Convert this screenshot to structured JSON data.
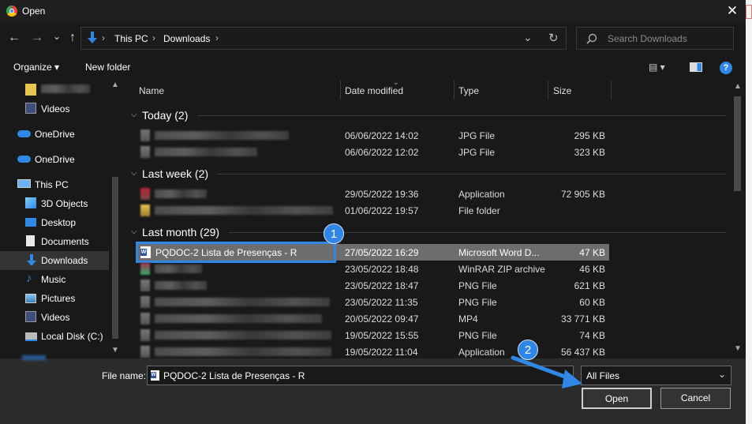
{
  "window": {
    "title": "Open",
    "close_icon": "close-icon"
  },
  "address": {
    "back": "←",
    "forward": "→",
    "recent": "⌄",
    "up": "↑",
    "crumbs": [
      "This PC",
      "Downloads"
    ],
    "dropdown": "⌄",
    "refresh": "↻",
    "search_placeholder": "Search Downloads"
  },
  "toolbar": {
    "organize": "Organize ▾",
    "new_folder": "New folder",
    "view": "▤ ▾",
    "help": "?"
  },
  "sidebar": {
    "items": [
      {
        "label": "Videos"
      },
      {
        "label": "OneDrive"
      },
      {
        "label": "OneDrive"
      },
      {
        "label": "This PC"
      },
      {
        "label": "3D Objects"
      },
      {
        "label": "Desktop"
      },
      {
        "label": "Documents"
      },
      {
        "label": "Downloads"
      },
      {
        "label": "Music"
      },
      {
        "label": "Pictures"
      },
      {
        "label": "Videos"
      },
      {
        "label": "Local Disk (C:)"
      }
    ]
  },
  "columns": {
    "name": "Name",
    "date": "Date modified",
    "type": "Type",
    "size": "Size"
  },
  "groups": [
    {
      "label": "Today (2)"
    },
    {
      "label": "Last week (2)"
    },
    {
      "label": "Last month (29)"
    }
  ],
  "rows": [
    {
      "name": "",
      "date": "06/06/2022 14:02",
      "type": "JPG File",
      "size": "295 KB"
    },
    {
      "name": "",
      "date": "06/06/2022 12:02",
      "type": "JPG File",
      "size": "323 KB"
    },
    {
      "name": "",
      "date": "29/05/2022 19:36",
      "type": "Application",
      "size": "72 905 KB"
    },
    {
      "name": "",
      "date": "01/06/2022 19:57",
      "type": "File folder",
      "size": ""
    },
    {
      "name": "PQDOC-2 Lista de Presenças - R",
      "date": "27/05/2022 16:29",
      "type": "Microsoft Word D...",
      "size": "47 KB"
    },
    {
      "name": "",
      "date": "23/05/2022 18:48",
      "type": "WinRAR ZIP archive",
      "size": "46 KB"
    },
    {
      "name": "",
      "date": "23/05/2022 18:47",
      "type": "PNG File",
      "size": "621 KB"
    },
    {
      "name": "",
      "date": "23/05/2022 11:35",
      "type": "PNG File",
      "size": "60 KB"
    },
    {
      "name": "",
      "date": "20/05/2022 09:47",
      "type": "MP4",
      "size": "33 771 KB"
    },
    {
      "name": "",
      "date": "19/05/2022 15:55",
      "type": "PNG File",
      "size": "74 KB"
    },
    {
      "name": "",
      "date": "19/05/2022 11:04",
      "type": "Application",
      "size": "56 437 KB"
    }
  ],
  "annotations": {
    "badge1": "1",
    "badge2": "2"
  },
  "footer": {
    "file_name_label": "File name:",
    "file_name_value": "PQDOC-2 Lista de Presenças - R",
    "file_type": "All Files",
    "open": "Open",
    "cancel": "Cancel"
  }
}
